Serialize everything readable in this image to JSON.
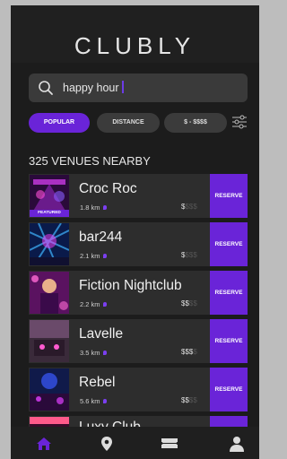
{
  "app": {
    "title": "CLUBLY"
  },
  "search": {
    "value": "happy hour"
  },
  "filters": [
    {
      "label": "POPULAR",
      "active": true
    },
    {
      "label": "DISTANCE",
      "active": false
    },
    {
      "label": "$ - $$$$",
      "active": false
    }
  ],
  "results": {
    "count_label": "325 VENUES NEARBY"
  },
  "venues": [
    {
      "name": "Croc Roc",
      "distance": "1.8 km",
      "price_on": "$",
      "price_off": "$$$",
      "badge": "FEATURED",
      "action": "RESERVE"
    },
    {
      "name": "bar244",
      "distance": "2.1 km",
      "price_on": "$",
      "price_off": "$$$",
      "action": "RESERVE"
    },
    {
      "name": "Fiction Nightclub",
      "distance": "2.2 km",
      "price_on": "$$",
      "price_off": "$$",
      "action": "RESERVE"
    },
    {
      "name": "Lavelle",
      "distance": "3.5 km",
      "price_on": "$$$",
      "price_off": "$",
      "action": "RESERVE"
    },
    {
      "name": "Rebel",
      "distance": "5.6 km",
      "price_on": "$$",
      "price_off": "$$",
      "action": "RESERVE"
    },
    {
      "name": "Luxy Club",
      "distance": "",
      "price_on": "",
      "price_off": "",
      "action": ""
    }
  ],
  "nav": [
    {
      "icon": "home-icon",
      "active": true
    },
    {
      "icon": "location-pin-icon",
      "active": false
    },
    {
      "icon": "tickets-icon",
      "active": false
    },
    {
      "icon": "profile-icon",
      "active": false
    }
  ],
  "colors": {
    "accent": "#6a24d8",
    "background": "#1c1c1c",
    "card": "#2d2d2d"
  }
}
